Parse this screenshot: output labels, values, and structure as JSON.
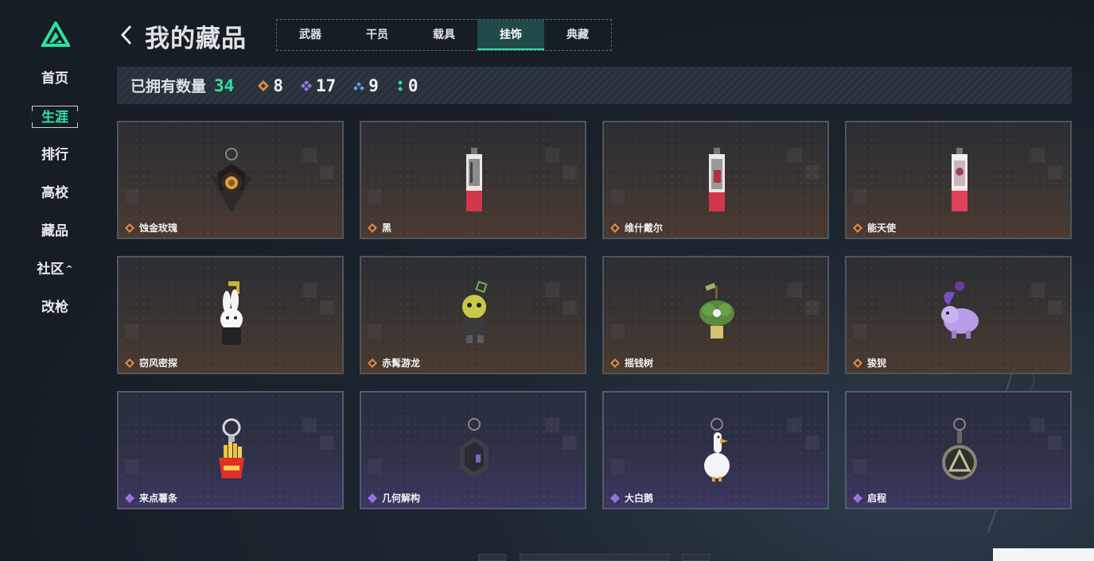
{
  "sidebar": {
    "items": [
      {
        "label": "首页"
      },
      {
        "label": "生涯",
        "active": true
      },
      {
        "label": "排行"
      },
      {
        "label": "高校"
      },
      {
        "label": "藏品"
      },
      {
        "label": "社区",
        "caret": "^"
      },
      {
        "label": "改枪"
      }
    ]
  },
  "header": {
    "title": "我的藏品",
    "tabs": [
      {
        "label": "武器"
      },
      {
        "label": "干员"
      },
      {
        "label": "载具"
      },
      {
        "label": "挂饰",
        "active": true
      },
      {
        "label": "典藏"
      }
    ]
  },
  "stats": {
    "label": "已拥有数量",
    "total": "34",
    "rarities": [
      {
        "icon": "orange-diamond-icon",
        "color": "#e08a4a",
        "value": "8"
      },
      {
        "icon": "purple-diamond-icon",
        "color": "#9b73e8",
        "value": "17"
      },
      {
        "icon": "blue-diamond-icon",
        "color": "#5a9ee0",
        "value": "9"
      },
      {
        "icon": "green-diamond-icon",
        "color": "#2fe0a0",
        "value": "0"
      }
    ]
  },
  "items": [
    {
      "name": "蚀金玫瑰",
      "rarity": "orange",
      "icon": "rose-charm-icon"
    },
    {
      "name": "黑",
      "rarity": "orange",
      "icon": "card-charm-icon"
    },
    {
      "name": "维什戴尔",
      "rarity": "orange",
      "icon": "card-charm-icon"
    },
    {
      "name": "能天使",
      "rarity": "orange",
      "icon": "card-charm-icon"
    },
    {
      "name": "窃风密探",
      "rarity": "orange",
      "icon": "rabbit-charm-icon"
    },
    {
      "name": "赤髯游龙",
      "rarity": "orange",
      "icon": "dragon-charm-icon"
    },
    {
      "name": "摇钱树",
      "rarity": "orange",
      "icon": "money-tree-charm-icon"
    },
    {
      "name": "狻猊",
      "rarity": "orange",
      "icon": "lion-charm-icon"
    },
    {
      "name": "来点薯条",
      "rarity": "purple",
      "icon": "fries-charm-icon"
    },
    {
      "name": "几何解构",
      "rarity": "purple",
      "icon": "geometric-charm-icon"
    },
    {
      "name": "大白鹅",
      "rarity": "purple",
      "icon": "goose-charm-icon"
    },
    {
      "name": "启程",
      "rarity": "purple",
      "icon": "medal-charm-icon"
    }
  ],
  "colors": {
    "accent": "#2fe0a0",
    "orange": "#e08a4a",
    "purple": "#9b73e8"
  }
}
